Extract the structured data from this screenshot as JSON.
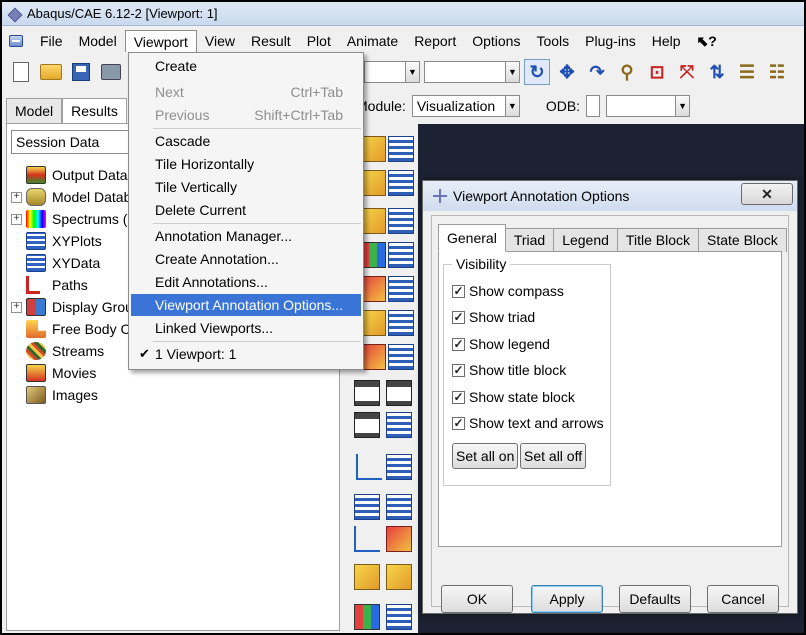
{
  "window": {
    "title": "Abaqus/CAE 6.12-2 [Viewport: 1]"
  },
  "menubar": {
    "items": [
      {
        "label": "File",
        "key": "F"
      },
      {
        "label": "Model",
        "key": "M"
      },
      {
        "label": "Viewport",
        "key": "V"
      },
      {
        "label": "View",
        "key": "V"
      },
      {
        "label": "Result",
        "key": "R"
      },
      {
        "label": "Plot",
        "key": "P"
      },
      {
        "label": "Animate",
        "key": "A"
      },
      {
        "label": "Report",
        "key": "R"
      },
      {
        "label": "Options",
        "key": "O"
      },
      {
        "label": "Tools",
        "key": "T"
      },
      {
        "label": "Plug-ins",
        "key": "g"
      },
      {
        "label": "Help",
        "key": "H"
      }
    ],
    "whats_this": "⬉?"
  },
  "module_bar": {
    "module_label": "Module:",
    "module_value": "Visualization",
    "odb_label": "ODB:",
    "odb_value": ""
  },
  "left_panel": {
    "tabs": [
      "Model",
      "Results"
    ],
    "session_combo": "Session Data",
    "tree": [
      {
        "label": "Output Data",
        "icon": "output-database-icon",
        "expandable": false
      },
      {
        "label": "Model Datab",
        "icon": "model-database-icon",
        "expandable": true
      },
      {
        "label": "Spectrums (",
        "icon": "spectrum-icon",
        "expandable": true
      },
      {
        "label": "XYPlots",
        "icon": "xyplot-icon",
        "expandable": false
      },
      {
        "label": "XYData",
        "icon": "xydata-icon",
        "expandable": false
      },
      {
        "label": "Paths",
        "icon": "path-icon",
        "expandable": false
      },
      {
        "label": "Display Grou",
        "icon": "display-group-icon",
        "expandable": true
      },
      {
        "label": "Free Body Cu",
        "icon": "free-body-cut-icon",
        "expandable": false
      },
      {
        "label": "Streams",
        "icon": "stream-icon",
        "expandable": false
      },
      {
        "label": "Movies",
        "icon": "movie-icon",
        "expandable": false
      },
      {
        "label": "Images",
        "icon": "image-icon",
        "expandable": false
      }
    ]
  },
  "viewport_menu": {
    "items": [
      {
        "label": "Create",
        "shortcut": "",
        "disabled": false
      },
      {
        "label": "Next",
        "shortcut": "Ctrl+Tab",
        "disabled": true
      },
      {
        "label": "Previous",
        "shortcut": "Shift+Ctrl+Tab",
        "disabled": true
      },
      {
        "label": "Cascade",
        "shortcut": "",
        "disabled": false
      },
      {
        "label": "Tile Horizontally",
        "shortcut": "",
        "disabled": false
      },
      {
        "label": "Tile Vertically",
        "shortcut": "",
        "disabled": false
      },
      {
        "label": "Delete Current",
        "shortcut": "",
        "disabled": false
      },
      {
        "label": "Annotation Manager...",
        "shortcut": "",
        "disabled": false
      },
      {
        "label": "Create Annotation...",
        "shortcut": "",
        "disabled": false
      },
      {
        "label": "Edit Annotations...",
        "shortcut": "",
        "disabled": false
      },
      {
        "label": "Viewport Annotation Options...",
        "shortcut": "",
        "disabled": false,
        "highlighted": true
      },
      {
        "label": "Linked Viewports...",
        "shortcut": "",
        "disabled": false
      },
      {
        "label": "1 Viewport: 1",
        "shortcut": "",
        "disabled": false,
        "checked": true
      }
    ]
  },
  "dialog": {
    "title": "Viewport Annotation Options",
    "close": "✕",
    "tabs": [
      "General",
      "Triad",
      "Legend",
      "Title Block",
      "State Block"
    ],
    "active_tab": "General",
    "group_title": "Visibility",
    "checkboxes": [
      {
        "label": "Show compass",
        "checked": true
      },
      {
        "label": "Show triad",
        "checked": true
      },
      {
        "label": "Show legend",
        "checked": true
      },
      {
        "label": "Show title block",
        "checked": true
      },
      {
        "label": "Show state block",
        "checked": true
      },
      {
        "label": "Show text and arrows",
        "checked": true
      }
    ],
    "set_all_on": "Set all on",
    "set_all_off": "Set all off",
    "buttons": {
      "ok": "OK",
      "apply": "Apply",
      "defaults": "Defaults",
      "cancel": "Cancel"
    }
  },
  "colors": {
    "highlight": "#3a74d6",
    "viewport_bg": "#1c2231"
  }
}
